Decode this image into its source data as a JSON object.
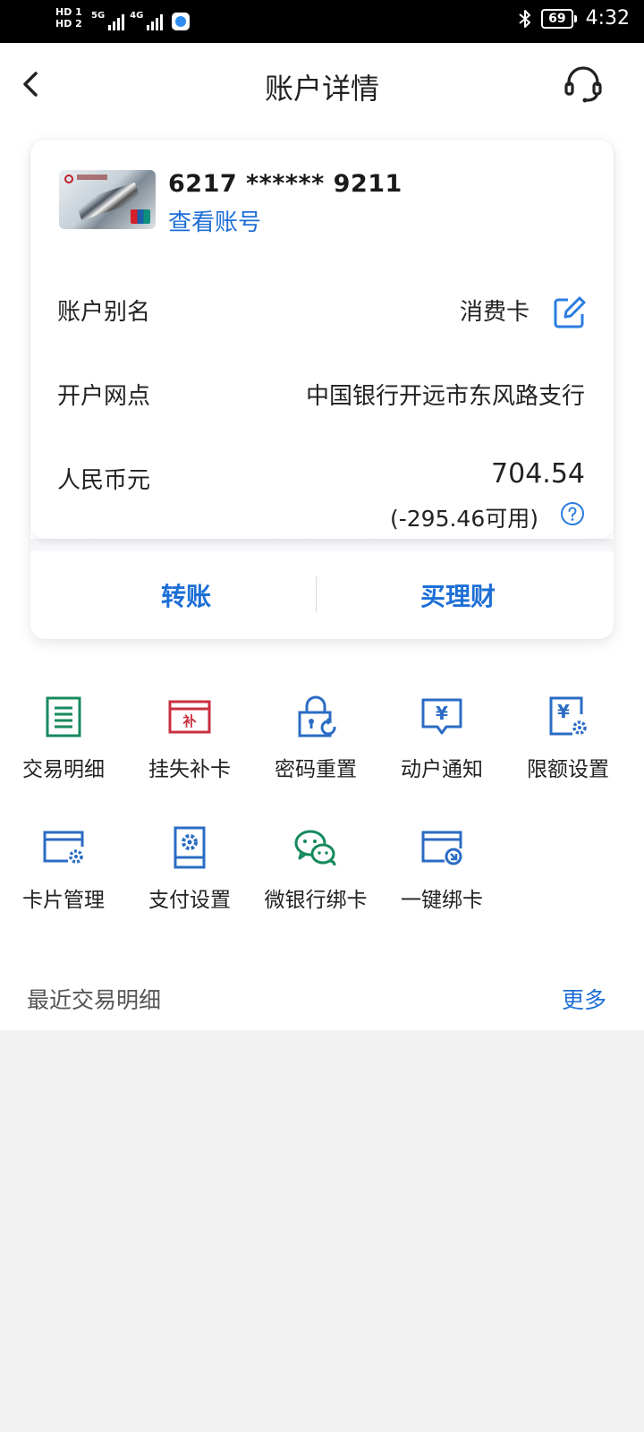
{
  "status_bar": {
    "hd1": "HD 1",
    "hd2": "HD 2",
    "net1": "5G",
    "net2": "4G",
    "battery": "69",
    "time": "4:32"
  },
  "header": {
    "title": "账户详情"
  },
  "account_card": {
    "card_number": "6217 ****** 9211",
    "view_account_label": "查看账号",
    "alias_label": "账户别名",
    "alias_value": "消费卡",
    "branch_label": "开户网点",
    "branch_value": "中国银行开远市东风路支行",
    "currency_label": "人民币元",
    "balance": "704.54",
    "available": "(-295.46可用)"
  },
  "actions": {
    "transfer": "转账",
    "buy_wealth": "买理财"
  },
  "functions": [
    {
      "label": "交易明细",
      "icon": "transaction-detail-icon",
      "color": "#178a5e"
    },
    {
      "label": "挂失补卡",
      "icon": "report-loss-icon",
      "color": "#c8303f"
    },
    {
      "label": "密码重置",
      "icon": "password-reset-icon",
      "color": "#2b6cc4"
    },
    {
      "label": "动户通知",
      "icon": "account-notice-icon",
      "color": "#2b6cc4"
    },
    {
      "label": "限额设置",
      "icon": "limit-settings-icon",
      "color": "#2b6cc4"
    },
    {
      "label": "卡片管理",
      "icon": "card-management-icon",
      "color": "#2b6cc4"
    },
    {
      "label": "支付设置",
      "icon": "payment-settings-icon",
      "color": "#2b6cc4"
    },
    {
      "label": "微银行绑卡",
      "icon": "wechat-bind-icon",
      "color": "#178a5e"
    },
    {
      "label": "一键绑卡",
      "icon": "one-click-bind-icon",
      "color": "#2b6cc4"
    }
  ],
  "recent": {
    "title": "最近交易明细",
    "more": "更多"
  },
  "colors": {
    "accent": "#1d6fd6",
    "green": "#178a5e",
    "red": "#c8303f",
    "background": "#f2f2f3"
  }
}
